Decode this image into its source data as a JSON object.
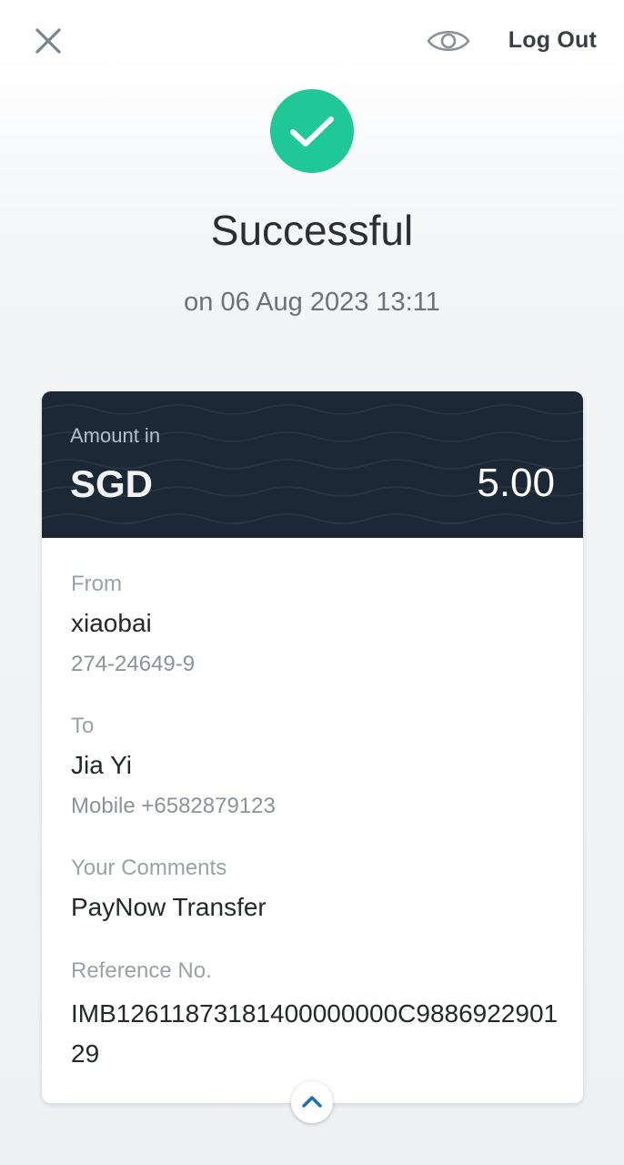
{
  "header": {
    "close_icon": "close-icon",
    "eye_icon": "eye-icon",
    "logout_label": "Log Out"
  },
  "status": {
    "icon": "check-circle-icon",
    "title": "Successful",
    "timestamp": "on 06 Aug 2023 13:11",
    "accent_color": "#1fc896"
  },
  "amount": {
    "label": "Amount in",
    "currency": "SGD",
    "value": "5.00",
    "header_color": "#1c2836"
  },
  "details": {
    "from": {
      "label": "From",
      "name": "xiaobai",
      "account": "274-24649-9"
    },
    "to": {
      "label": "To",
      "name": "Jia Yi",
      "mobile": "Mobile +6582879123"
    },
    "comments": {
      "label": "Your Comments",
      "value": "PayNow Transfer"
    },
    "reference": {
      "label": "Reference No.",
      "value": "IMB12611873181400000000C988692290129"
    }
  },
  "footer": {
    "collapse_icon": "chevron-up-icon"
  }
}
